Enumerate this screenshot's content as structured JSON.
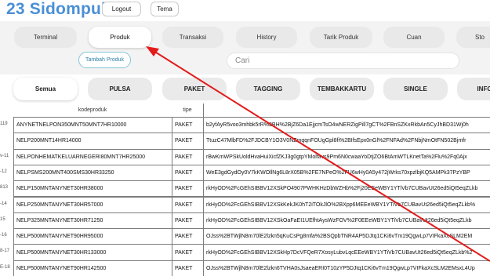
{
  "app": {
    "title": "23 Sidompul"
  },
  "header": {
    "logout_label": "Logout",
    "tema_label": "Tema"
  },
  "main_tabs": [
    "Terminal",
    "Produk",
    "Transaksi",
    "History",
    "Tarik Produk",
    "Cuan",
    "Sto"
  ],
  "active_main_tab": "Produk",
  "toolbar": {
    "add_label": "Tambah Produk",
    "search_placeholder": "Cari"
  },
  "category_tabs": [
    "Semua",
    "PULSA",
    "PAKET",
    "TAGGING",
    "TEMBAKKARTU",
    "SINGLE",
    "INFO"
  ],
  "active_category_tab": "Semua",
  "table": {
    "columns": [
      "kodeproduk",
      "tipe",
      ""
    ],
    "rows": [
      {
        "idx": "119",
        "kode": "ANYNETNELPON350MNT50MNT7HR10000",
        "tipe": "PAKET",
        "data": "b2yfAyR5voo3mhbk5rR%2BH%2BjZ6Da1EjjcmTsO4wNERZigPill7gCT%2FBnSZKxRkbAn5CyJhBD31Wj0h"
      },
      {
        "idx": "",
        "kode": "NELP200MNT14HR14000",
        "tipe": "PAKET",
        "data": "TtuzC47MlbFD%2FJDCBY1O3V0NZmqqnFOUgGpl8fi%2BIfsEpx0nGl%2FNFAd%2FNbjNmOtFN502Bjmfr"
      },
      {
        "idx": "v-11",
        "kode": "NELPONHEMATKELUARNEGERI80MNT7HR25000",
        "tipe": "PAKET",
        "data": "rBwKmWPSkUoldHvaHuiXicfZKJ3g0gtpYMolfavs9Pm6N0cwaaYoDtjZO6BtAmWTLKnetTa%2Flu%2Fq0Ajx"
      },
      {
        "idx": "-12",
        "kode": "NELPSMS200MNT400SMS30HR33250",
        "tipe": "PAKET",
        "data": "WeE3gdGydOy0V7kKWOllNg6L8rX05B%2FE7NPeO%2FU6wHy0A5y472jWrks70xpzlbjKQ5AMPk37PzYBP"
      },
      {
        "idx": "813",
        "kode": "NELP150MNTANYNET30HR38000",
        "tipe": "PAKET",
        "data": "rkHyOD%2FcGEhSIBBV12XSkPO4907PWHKHzDbWZHb%2Fj20EEeWBY1YTiVb7CUBavUt26ed5iQt5eqZLkb"
      },
      {
        "idx": "-14",
        "kode": "NELP250MNTANYNET30HR57000",
        "tipe": "PAKET",
        "data": "rkHyOD%2FcGEhSIBBV12XSkKekJK0hT2iTOkJlO%2BXpp6MEEeWBY1YTiVb7CUBavUt26ed5iQt5eqZLkb%"
      },
      {
        "idx": "15",
        "kode": "NELP325MNTANYNET30HR71250",
        "tipe": "PAKET",
        "data": "rkHyOD%2FcGEhSIBBV12XSkOaFaEI1UEfhtAysWzFOV%2F0EEeWBY1YTiVb7CUBavUt26ed5iQt5eqZLkb"
      },
      {
        "idx": "-16",
        "kode": "NELP500MNTANYNET90HR95000",
        "tipe": "PAKET",
        "data": "OJss%2BTWjlN8m70lE2lzkn5qKuCsPg8mfa%2BSQpbTNR4AP5DJtq1CKi6vTm19QgwLp7VIFkaXcSLM2EM"
      },
      {
        "idx": "8-17",
        "kode": "NELP500MNTANYNET30HR133000",
        "tipe": "PAKET",
        "data": "rkHyOD%2FcGEhSIBBV12XSkHp7DcVFQeR7XosyLubvLqcEEeWBY1YTiVb7CUBavUt26ed5iQt5eqZLkb%2"
      },
      {
        "idx": "E-18",
        "kode": "NELP500MNTANYNET90HR142500",
        "tipe": "PAKET",
        "data": "OJss%2BTWjlN8m70lE2lzkn6TVHA0sJsaeaERI0T10zYP5DJtq1CKi6vTm19QgwLp7VIFkaXcSLM2EMsxL4Up"
      }
    ]
  },
  "colors": {
    "title": "#4a8fd6",
    "annotation_arrow": "#e31b1b",
    "add_button_border": "#86c4d6"
  }
}
